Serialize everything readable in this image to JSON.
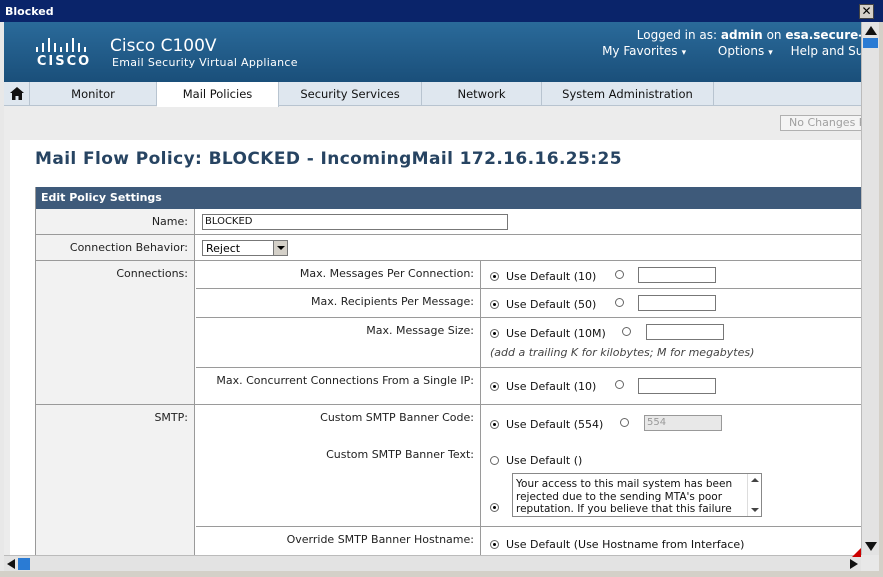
{
  "window": {
    "title": "Blocked",
    "close_symbol": "✕"
  },
  "header": {
    "logo_text": "CISCO",
    "product": "Cisco C100V",
    "product_sub": "Email Security Virtual Appliance",
    "login_prefix": "Logged in as:",
    "login_user": "admin",
    "login_on": "on",
    "login_host": "esa.secure-x",
    "menu": {
      "favorites": "My Favorites",
      "options": "Options",
      "help": "Help and Sup"
    }
  },
  "nav": {
    "tabs": [
      {
        "label": "Monitor"
      },
      {
        "label": "Mail Policies"
      },
      {
        "label": "Security Services"
      },
      {
        "label": "Network"
      },
      {
        "label": "System Administration"
      }
    ],
    "active": "Mail Policies"
  },
  "changes_button": "No Changes P",
  "page_title": "Mail Flow Policy: BLOCKED - IncomingMail 172.16.16.25:25",
  "settings": {
    "header": "Edit Policy Settings",
    "name_label": "Name:",
    "name_value": "BLOCKED",
    "connection_behavior_label": "Connection Behavior:",
    "connection_behavior_value": "Reject",
    "connections_label": "Connections:",
    "max_msgs_label": "Max. Messages Per Connection:",
    "max_msgs_default": "Use Default (10)",
    "max_rcpts_label": "Max. Recipients Per Message:",
    "max_rcpts_default": "Use Default (50)",
    "max_size_label": "Max. Message Size:",
    "max_size_default": "Use Default (10M)",
    "max_size_hint": "(add a trailing K for kilobytes; M for megabytes)",
    "max_concurrent_label": "Max. Concurrent Connections From a Single IP:",
    "max_concurrent_default": "Use Default (10)",
    "smtp_label": "SMTP:",
    "banner_code_label": "Custom SMTP Banner Code:",
    "banner_code_default": "Use Default (554)",
    "banner_code_value": "554",
    "banner_text_label": "Custom SMTP Banner Text:",
    "banner_text_default": "Use Default ()",
    "banner_text_value": "Your access to this mail system has been rejected due to the sending MTA's poor reputation. If you believe that this failure",
    "override_hostname_label": "Override SMTP Banner Hostname:",
    "override_hostname_default": "Use Default (Use Hostname from Interface)"
  },
  "colors": {
    "header_blue": "#1e5a8a",
    "section_header": "#3e5a7a",
    "title_text": "#274462",
    "scroll_thumb": "#2a7bd4"
  }
}
